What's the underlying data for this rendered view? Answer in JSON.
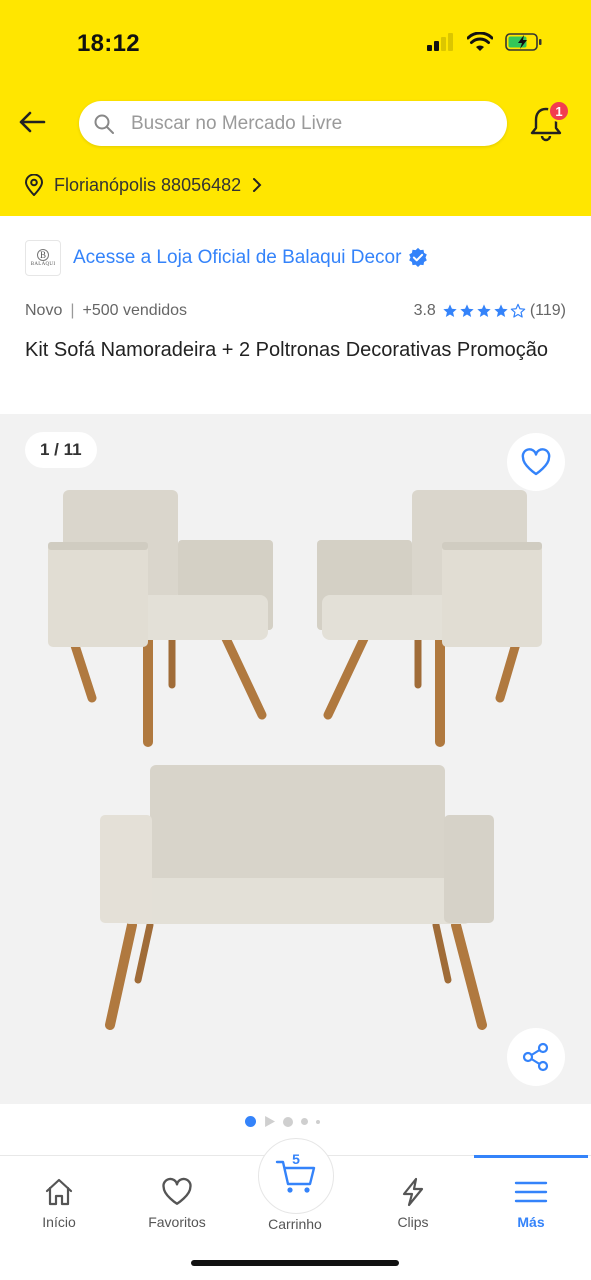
{
  "status_bar": {
    "time": "18:12"
  },
  "header": {
    "search_placeholder": "Buscar no Mercado Livre",
    "notification_count": "1",
    "location": "Florianópolis 88056482"
  },
  "store": {
    "logo_letter": "B",
    "logo_text": "BALAQUI",
    "link": "Acesse a Loja Oficial de Balaqui Decor"
  },
  "product": {
    "condition": "Novo",
    "separator": "|",
    "sold": "+500 vendidos",
    "rating": "3.8",
    "rating_stars": 3.8,
    "reviews": "(119)",
    "title": "Kit Sofá Namoradeira + 2 Poltronas Decorativas Promoção"
  },
  "gallery": {
    "counter": "1 / 11",
    "current_image": 1,
    "total_images": 11
  },
  "bottom_nav": {
    "items": [
      {
        "label": "Início",
        "icon": "home-icon"
      },
      {
        "label": "Favoritos",
        "icon": "heart-icon"
      },
      {
        "label": "Carrinho",
        "icon": "cart-icon",
        "count": "5"
      },
      {
        "label": "Clips",
        "icon": "bolt-icon"
      },
      {
        "label": "Más",
        "icon": "menu-icon",
        "active": true
      }
    ]
  },
  "colors": {
    "header_yellow": "#FFE600",
    "link_blue": "#3483FA",
    "badge_red": "#F23D4F"
  }
}
